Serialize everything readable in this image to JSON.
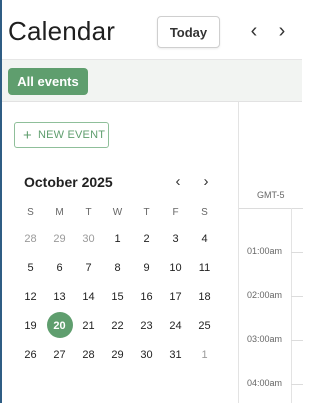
{
  "header": {
    "title": "Calendar",
    "today_label": "Today",
    "prev_icon": "‹",
    "next_icon": "›"
  },
  "filters": {
    "all_events_label": "All events"
  },
  "sidebar": {
    "new_event_label": "NEW EVENT",
    "new_event_icon": "+",
    "month_label": "October 2025",
    "prev_icon": "‹",
    "next_icon": "›",
    "weekdays": [
      "S",
      "M",
      "T",
      "W",
      "T",
      "F",
      "S"
    ],
    "weeks": [
      [
        "28",
        "29",
        "30",
        "1",
        "2",
        "3",
        "4"
      ],
      [
        "5",
        "6",
        "7",
        "8",
        "9",
        "10",
        "11"
      ],
      [
        "12",
        "13",
        "14",
        "15",
        "16",
        "17",
        "18"
      ],
      [
        "19",
        "20",
        "21",
        "22",
        "23",
        "24",
        "25"
      ],
      [
        "26",
        "27",
        "28",
        "29",
        "30",
        "31",
        "1"
      ]
    ],
    "muted": [
      [
        0,
        0
      ],
      [
        0,
        1
      ],
      [
        0,
        2
      ],
      [
        4,
        6
      ]
    ],
    "selected": [
      3,
      1
    ]
  },
  "timeline": {
    "timezone": "GMT-5",
    "hours": [
      "01:00am",
      "02:00am",
      "03:00am",
      "04:00am"
    ]
  },
  "colors": {
    "accent": "#5f9e6e",
    "frame": "#2f5d84"
  }
}
